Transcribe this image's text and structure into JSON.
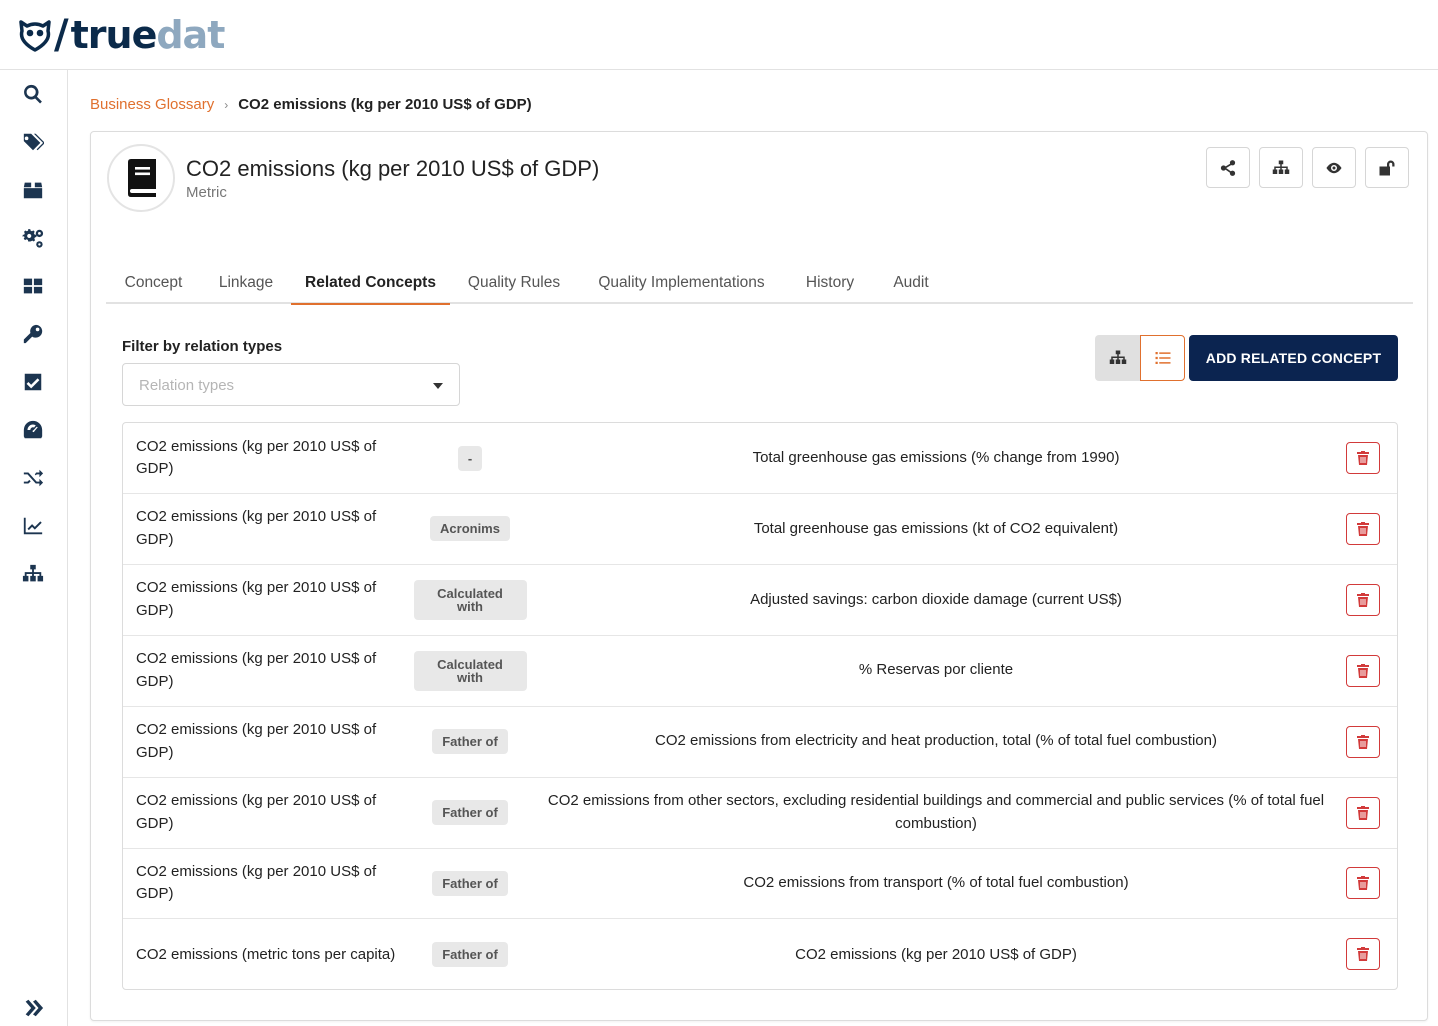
{
  "app": {
    "logo_true": "true",
    "logo_dat": "dat",
    "logo_slash": "/"
  },
  "sidebar": {
    "items": [
      {
        "icon": "search-icon"
      },
      {
        "icon": "tags-icon"
      },
      {
        "icon": "box-icon"
      },
      {
        "icon": "gears-icon"
      },
      {
        "icon": "grid-icon"
      },
      {
        "icon": "key-icon"
      },
      {
        "icon": "checkbox-icon"
      },
      {
        "icon": "gauge-icon"
      },
      {
        "icon": "shuffle-icon"
      },
      {
        "icon": "chart-line-icon"
      },
      {
        "icon": "sitemap-icon"
      }
    ],
    "expand_icon": "double-chevron-right-icon"
  },
  "breadcrumb": {
    "parent": "Business Glossary",
    "separator": "›",
    "current": "CO2 emissions (kg per 2010 US$ of GDP)"
  },
  "concept": {
    "title": "CO2 emissions (kg per 2010 US$ of GDP)",
    "type": "Metric",
    "icon": "book-icon"
  },
  "actions": [
    {
      "name": "share",
      "icon": "share-icon"
    },
    {
      "name": "structure",
      "icon": "sitemap-icon"
    },
    {
      "name": "watch",
      "icon": "eye-icon"
    },
    {
      "name": "lock",
      "icon": "unlock-icon"
    }
  ],
  "tabs": [
    {
      "label": "Concept",
      "active": false
    },
    {
      "label": "Linkage",
      "active": false
    },
    {
      "label": "Related Concepts",
      "active": true
    },
    {
      "label": "Quality Rules",
      "active": false
    },
    {
      "label": "Quality Implementations",
      "active": false
    },
    {
      "label": "History",
      "active": false
    },
    {
      "label": "Audit",
      "active": false
    }
  ],
  "filter": {
    "label": "Filter by relation types",
    "placeholder": "Relation types"
  },
  "toolbar": {
    "add_label": "ADD RELATED CONCEPT",
    "accent": "#e0702e",
    "primary": "#0b2450"
  },
  "relations": [
    {
      "source": "CO2 emissions (kg per 2010 US$ of GDP)",
      "type": "-",
      "target": "Total greenhouse gas emissions (% change from 1990)"
    },
    {
      "source": "CO2 emissions (kg per 2010 US$ of GDP)",
      "type": "Acronims",
      "target": "Total greenhouse gas emissions (kt of CO2 equivalent)"
    },
    {
      "source": "CO2 emissions (kg per 2010 US$ of GDP)",
      "type": "Calculated with",
      "target": "Adjusted savings: carbon dioxide damage (current US$)"
    },
    {
      "source": "CO2 emissions (kg per 2010 US$ of GDP)",
      "type": "Calculated with",
      "target": "% Reservas por cliente"
    },
    {
      "source": "CO2 emissions (kg per 2010 US$ of GDP)",
      "type": "Father of",
      "target": "CO2 emissions from electricity and heat production, total (% of total fuel combustion)"
    },
    {
      "source": "CO2 emissions (kg per 2010 US$ of GDP)",
      "type": "Father of",
      "target": "CO2 emissions from other sectors, excluding residential buildings and commercial and public services (% of total fuel combustion)"
    },
    {
      "source": "CO2 emissions (kg per 2010 US$ of GDP)",
      "type": "Father of",
      "target": "CO2 emissions from transport (% of total fuel combustion)"
    },
    {
      "source": "CO2 emissions (metric tons per capita)",
      "type": "Father of",
      "target": "CO2 emissions (kg per 2010 US$ of GDP)"
    }
  ]
}
